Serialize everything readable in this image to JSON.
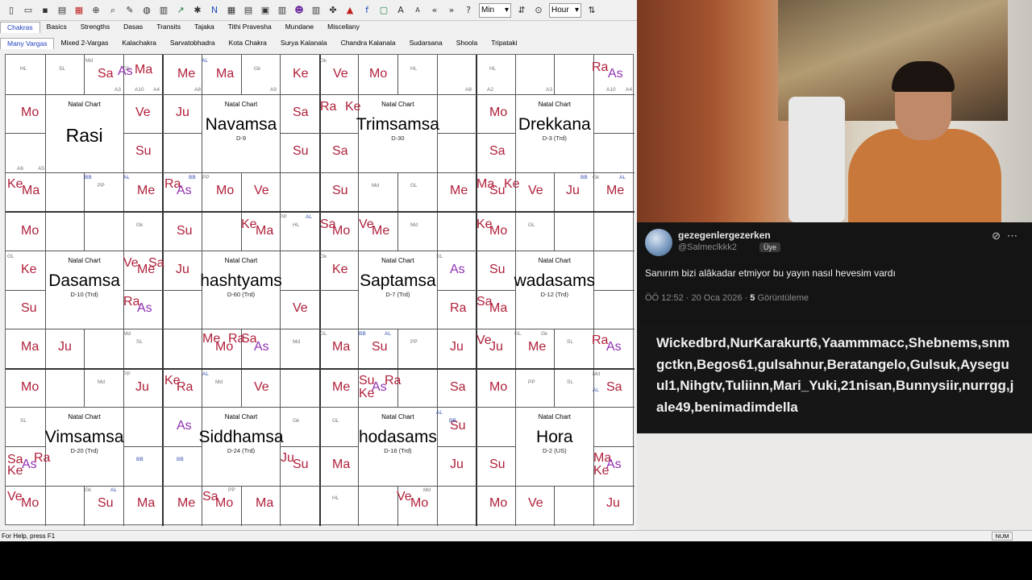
{
  "toolbar": {
    "icons": [
      "new-icon",
      "open-icon",
      "save-icon",
      "print-icon",
      "chart-icon",
      "zoom-icon",
      "search-icon",
      "settings-icon",
      "globe-icon",
      "calc-icon",
      "graph-icon",
      "compass-icon",
      "note-icon",
      "grid-icon",
      "table-icon",
      "box-icon",
      "layout-icon",
      "people-icon",
      "book-icon",
      "puzzle-icon",
      "tree-icon",
      "facebook-icon",
      "font-icon",
      "text-a-icon",
      "text-a-small-icon",
      "back-icon",
      "forward-icon",
      "help-icon",
      "nav-icon"
    ],
    "min_select": "Min",
    "hour_select": "Hour"
  },
  "tabs_top": [
    "Chakras",
    "Basics",
    "Strengths",
    "Dasas",
    "Transits",
    "Tajaka",
    "Tithi Pravesha",
    "Mundane",
    "Miscellany"
  ],
  "tabs_sub": [
    "Many Vargas",
    "Mixed 2-Vargas",
    "Kalachakra",
    "Sarvatobhadra",
    "Kota Chakra",
    "Surya Kalanala",
    "Chandra Kalanala",
    "Sudarsana",
    "Shoola",
    "Tripataki"
  ],
  "charts": [
    {
      "title": "Natal Chart",
      "name": "Rasi",
      "sub": ""
    },
    {
      "title": "Natal Chart",
      "name": "Navamsa",
      "sub": "D-9"
    },
    {
      "title": "Natal Chart",
      "name": "Trimsamsa",
      "sub": "D-30"
    },
    {
      "title": "Natal Chart",
      "name": "Drekkana",
      "sub": "D-3 (Trd)"
    },
    {
      "title": "Natal Chart",
      "name": "Dasamsa",
      "sub": "D-10 (Trd)"
    },
    {
      "title": "Natal Chart",
      "name": "hashtyams",
      "sub": "D-60 (Trd)"
    },
    {
      "title": "Natal Chart",
      "name": "Saptamsa",
      "sub": "D-7 (Trd)"
    },
    {
      "title": "Natal Chart",
      "name": "wadasams",
      "sub": "D-12 (Trd)"
    },
    {
      "title": "Natal Chart",
      "name": "Vimsamsa",
      "sub": "D-20 (Trd)"
    },
    {
      "title": "Natal Chart",
      "name": "Siddhamsa",
      "sub": "D-24 (Trd)"
    },
    {
      "title": "Natal Chart",
      "name": "hodasams",
      "sub": "D-16 (Trd)"
    },
    {
      "title": "Natal Chart",
      "name": "Hora",
      "sub": "D-2 (US)"
    }
  ],
  "planets": [
    [
      "Sa",
      120,
      83
    ],
    [
      "As",
      145,
      80
    ],
    [
      "Ma",
      166,
      78
    ],
    [
      "Me",
      219,
      83
    ],
    [
      "Ma",
      267,
      83
    ],
    [
      "Ke",
      362,
      83
    ],
    [
      "Ve",
      412,
      83
    ],
    [
      "Mo",
      457,
      83
    ],
    [
      "Ra",
      733,
      75
    ],
    [
      "As",
      753,
      83
    ],
    [
      "Mo",
      25,
      131
    ],
    [
      "Ve",
      167,
      131
    ],
    [
      "Ju",
      217,
      131
    ],
    [
      "Sa",
      362,
      131
    ],
    [
      "Ra",
      396,
      124
    ],
    [
      "Ke",
      427,
      124
    ],
    [
      "Mo",
      606,
      131
    ],
    [
      "Su",
      167,
      179
    ],
    [
      "Su",
      362,
      179
    ],
    [
      "Sa",
      411,
      179
    ],
    [
      "Sa",
      606,
      179
    ],
    [
      "Ke",
      8,
      220
    ],
    [
      "Ma",
      26,
      228
    ],
    [
      "Me",
      169,
      228
    ],
    [
      "Ra",
      203,
      220
    ],
    [
      "As",
      218,
      228
    ],
    [
      "Mo",
      267,
      228
    ],
    [
      "Ve",
      314,
      228
    ],
    [
      "Su",
      411,
      228
    ],
    [
      "Me",
      557,
      228
    ],
    [
      "Ma",
      590,
      220
    ],
    [
      "Su",
      606,
      228
    ],
    [
      "Ke",
      624,
      220
    ],
    [
      "Ve",
      654,
      228
    ],
    [
      "Ju",
      701,
      228
    ],
    [
      "Me",
      751,
      228
    ],
    [
      "Mo",
      25,
      278
    ],
    [
      "Su",
      218,
      278
    ],
    [
      "Ke",
      298,
      270
    ],
    [
      "Ma",
      316,
      278
    ],
    [
      "Sa",
      396,
      270
    ],
    [
      "Mo",
      411,
      278
    ],
    [
      "Ve",
      444,
      270
    ],
    [
      "Me",
      460,
      278
    ],
    [
      "Ke",
      590,
      270
    ],
    [
      "Mo",
      606,
      278
    ],
    [
      "Ke",
      25,
      326
    ],
    [
      "Ve",
      152,
      318
    ],
    [
      "Sa",
      183,
      318
    ],
    [
      "Me",
      169,
      326
    ],
    [
      "Ju",
      217,
      326
    ],
    [
      "Ke",
      411,
      326
    ],
    [
      "As",
      557,
      326
    ],
    [
      "Su",
      606,
      326
    ],
    [
      "Su",
      25,
      374
    ],
    [
      "Ra",
      152,
      366
    ],
    [
      "As",
      169,
      374
    ],
    [
      "Ve",
      362,
      374
    ],
    [
      "Ra",
      557,
      374
    ],
    [
      "Sa",
      590,
      366
    ],
    [
      "Ma",
      606,
      374
    ],
    [
      "Ma",
      25,
      422
    ],
    [
      "Ju",
      71,
      422
    ],
    [
      "Me",
      250,
      412
    ],
    [
      "Ra",
      282,
      412
    ],
    [
      "Sa",
      298,
      412
    ],
    [
      "Mo",
      266,
      422
    ],
    [
      "As",
      314,
      422
    ],
    [
      "Ma",
      411,
      422
    ],
    [
      "Su",
      460,
      422
    ],
    [
      "Ju",
      557,
      422
    ],
    [
      "Ve",
      590,
      414
    ],
    [
      "Ju",
      606,
      422
    ],
    [
      "Me",
      654,
      422
    ],
    [
      "Ra",
      733,
      414
    ],
    [
      "As",
      751,
      422
    ],
    [
      "Mo",
      25,
      472
    ],
    [
      "Ju",
      167,
      472
    ],
    [
      "Ke",
      203,
      464
    ],
    [
      "Ra",
      218,
      472
    ],
    [
      "Ve",
      314,
      472
    ],
    [
      "Me",
      411,
      472
    ],
    [
      "Su",
      444,
      464
    ],
    [
      "Ra",
      476,
      464
    ],
    [
      "Ke",
      444,
      480
    ],
    [
      "As",
      460,
      472
    ],
    [
      "Sa",
      557,
      472
    ],
    [
      "Mo",
      606,
      472
    ],
    [
      "Sa",
      751,
      472
    ],
    [
      "As",
      218,
      520
    ],
    [
      "Su",
      557,
      520
    ],
    [
      "Sa",
      8,
      562
    ],
    [
      "As",
      26,
      568
    ],
    [
      "Ra",
      41,
      560
    ],
    [
      "Ke",
      8,
      576
    ],
    [
      "Ju",
      347,
      560
    ],
    [
      "Su",
      362,
      568
    ],
    [
      "Ma",
      411,
      568
    ],
    [
      "Ju",
      557,
      568
    ],
    [
      "Su",
      606,
      568
    ],
    [
      "Ma",
      735,
      560
    ],
    [
      "As",
      751,
      568
    ],
    [
      "Ke",
      735,
      576
    ],
    [
      "Ve",
      8,
      608
    ],
    [
      "Mo",
      25,
      616
    ],
    [
      "Su",
      120,
      616
    ],
    [
      "Ma",
      169,
      616
    ],
    [
      "Me",
      219,
      616
    ],
    [
      "Sa",
      250,
      608
    ],
    [
      "Mo",
      266,
      616
    ],
    [
      "Ma",
      316,
      616
    ],
    [
      "Ve",
      491,
      608
    ],
    [
      "Mo",
      508,
      616
    ],
    [
      "Mo",
      606,
      616
    ],
    [
      "Ve",
      654,
      616
    ],
    [
      "Ju",
      751,
      616
    ]
  ],
  "small_labels": [
    [
      "HL",
      24,
      82
    ],
    [
      "SL",
      72,
      82
    ],
    [
      "Md",
      105,
      72
    ],
    [
      "GL",
      152,
      82
    ],
    [
      "AL",
      249,
      72
    ],
    [
      "Gk",
      314,
      82
    ],
    [
      "Gk",
      396,
      72
    ],
    [
      "HL",
      508,
      82
    ],
    [
      "HL",
      606,
      82
    ],
    [
      "A6",
      20,
      206
    ],
    [
      "A5",
      46,
      206
    ],
    [
      "A3",
      141,
      108
    ],
    [
      "A10",
      166,
      108
    ],
    [
      "A4",
      189,
      108
    ],
    [
      "A8",
      240,
      108
    ],
    [
      "A9",
      334,
      108
    ],
    [
      "A8",
      576,
      108
    ],
    [
      "A2",
      603,
      108
    ],
    [
      "A3",
      676,
      108
    ],
    [
      "A10",
      751,
      108
    ],
    [
      "A4",
      775,
      108
    ],
    [
      "BB",
      104,
      217
    ],
    [
      "PP",
      120,
      227
    ],
    [
      "AL",
      152,
      217
    ],
    [
      "BB",
      233,
      217
    ],
    [
      "PP",
      250,
      217
    ],
    [
      "Md",
      460,
      227
    ],
    [
      "GL",
      508,
      227
    ],
    [
      "Gk",
      734,
      217
    ],
    [
      "BB",
      719,
      217
    ],
    [
      "AL",
      767,
      217
    ],
    [
      "Gk",
      168,
      276
    ],
    [
      "PP",
      346,
      266
    ],
    [
      "AL",
      378,
      266
    ],
    [
      "HL",
      362,
      276
    ],
    [
      "Md",
      508,
      276
    ],
    [
      "GL",
      654,
      276
    ],
    [
      "GL",
      8,
      315
    ],
    [
      "Gk",
      396,
      315
    ],
    [
      "SL",
      540,
      315
    ],
    [
      "Md",
      152,
      411
    ],
    [
      "SL",
      168,
      421
    ],
    [
      "Md",
      362,
      421
    ],
    [
      "GL",
      396,
      411
    ],
    [
      "BB",
      444,
      411
    ],
    [
      "AL",
      476,
      411
    ],
    [
      "PP",
      508,
      421
    ],
    [
      "GL",
      637,
      411
    ],
    [
      "Gk",
      670,
      411
    ],
    [
      "SL",
      702,
      421
    ],
    [
      "PP",
      152,
      461
    ],
    [
      "Md",
      120,
      471
    ],
    [
      "Md",
      266,
      471
    ],
    [
      "AL",
      250,
      461
    ],
    [
      "PP",
      654,
      471
    ],
    [
      "SL",
      702,
      471
    ],
    [
      "Md",
      734,
      461
    ],
    [
      "AL",
      734,
      481
    ],
    [
      "SL",
      24,
      519
    ],
    [
      "Gk",
      362,
      519
    ],
    [
      "GL",
      411,
      519
    ],
    [
      "AL",
      540,
      509
    ],
    [
      "BB",
      556,
      519
    ],
    [
      "BB",
      168,
      567
    ],
    [
      "BB",
      218,
      567
    ],
    [
      "Gk",
      104,
      605
    ],
    [
      "AL",
      136,
      605
    ],
    [
      "PP",
      282,
      605
    ],
    [
      "HL",
      411,
      615
    ],
    [
      "Md",
      524,
      605
    ]
  ],
  "statusbar": {
    "help": "For Help, press F1",
    "num": "NUM"
  },
  "tweet": {
    "name": "gezegenlergezerken",
    "handle": "@Salmeclkkk2",
    "badge": "Üye",
    "text": "Sanırım bizi alâkadar etmiyor bu yayın nasıl hevesim vardı",
    "time": "ÖÖ 12:52 · 20 Oca 2026 ·",
    "views_count": "5",
    "views_label": "Görüntüleme"
  },
  "names_list": "Wickedbrd,NurKarakurt6,Yaammmacc,Shebnems,snmgctkn,Begos61,gulsahnur,Beratangelo,Gulsuk,Ayseguul1,Nihgtv,Tuliinn,Mari_Yuki,21nisan,Bunnysiir,nurrgg,jale49,benimadimdella"
}
